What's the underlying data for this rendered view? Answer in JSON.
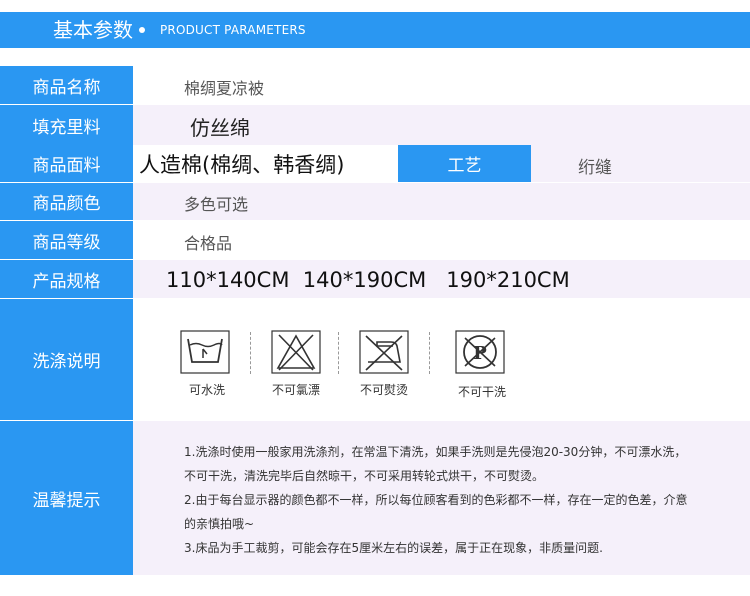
{
  "header": {
    "title": "基本参数",
    "subtitle": "PRODUCT PARAMETERS"
  },
  "rows": [
    {
      "label": "商品名称",
      "value": "棉绸夏凉被"
    },
    {
      "label": "填充里料",
      "value": "仿丝绵"
    },
    {
      "label": "商品面料",
      "value": "人造棉(棉绸、韩香绸)",
      "extra_label": "工艺",
      "extra_value": "绗缝"
    },
    {
      "label": "商品颜色",
      "value": "多色可选"
    },
    {
      "label": "商品等级",
      "value": "合格品"
    },
    {
      "label": "产品规格",
      "value": "110*140CM  140*190CM   190*210CM"
    },
    {
      "label": "洗涤说明"
    },
    {
      "label": "温馨提示"
    }
  ],
  "care": {
    "icons": [
      {
        "icon": "hand-wash-icon",
        "label": "可水洗"
      },
      {
        "icon": "no-bleach-icon",
        "label": "不可氯漂"
      },
      {
        "icon": "no-iron-icon",
        "label": "不可熨烫"
      },
      {
        "icon": "no-dry-clean-icon",
        "label": "不可干洗"
      }
    ]
  },
  "tips": [
    "1.洗涤时使用一般家用洗涤剂，在常温下清洗，如果手洗则是先侵泡20-30分钟，不可漂水洗，",
    "不可干洗，清洗完毕后自然晾干，不可采用转轮式烘干，不可熨烫。",
    "2.由于每台显示器的颜色都不一样，所以每位顾客看到的色彩都不一样，存在一定的色差，介意",
    "的亲慎拍哦~",
    "3.床品为手工裁剪，可能会存在5厘米左右的误差，属于正在现象，非质量问题."
  ],
  "colors": {
    "accent": "#2a97f2",
    "row_alt": "#f5f0fa"
  }
}
